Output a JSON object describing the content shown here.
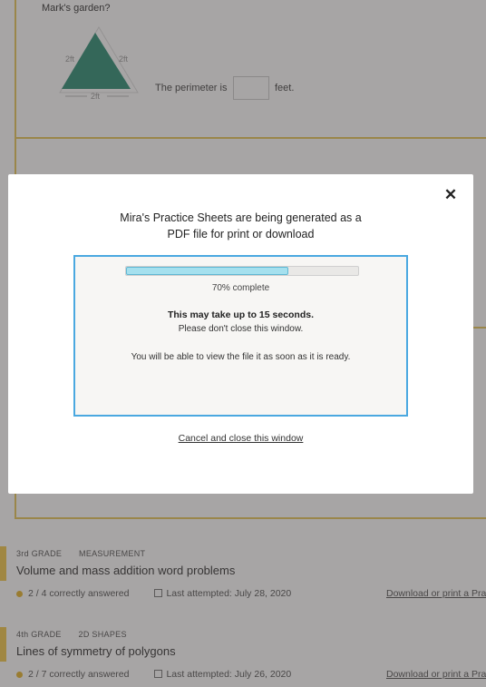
{
  "background": {
    "question": {
      "title": "Mark's garden?",
      "side_labels": [
        "2ft",
        "2ft",
        "2ft"
      ],
      "perimeter_label": "The perimeter is",
      "answer_value": "",
      "unit": "feet."
    },
    "items": [
      {
        "grade": "3rd GRADE",
        "topic": "MEASUREMENT",
        "title": "Volume and mass addition word problems",
        "score": "2 / 4 correctly answered",
        "last_attempted": "Last attempted: July 28, 2020",
        "download": "Download or print a Pra"
      },
      {
        "grade": "4th GRADE",
        "topic": "2D SHAPES",
        "title": "Lines of symmetry of polygons",
        "score": "2 / 7 correctly answered",
        "last_attempted": "Last attempted: July 26, 2020",
        "download": "Download or print a Pra"
      }
    ]
  },
  "modal": {
    "title_line1": "Mira's Practice Sheets are being generated as a",
    "title_line2": "PDF file for print or download",
    "close_icon": "close-icon",
    "progress": {
      "value": 0.7,
      "label": "70% complete"
    },
    "wait_strong": "This may take up to 15 seconds.",
    "wait_note": "Please don't close this window.",
    "ready_note": "You will be able to view the file it as soon as it is ready.",
    "cancel_label": "Cancel and close this window"
  },
  "colors": {
    "overlay": "#3c3737",
    "accent_yellow": "#f2c94c",
    "frame_yellow": "#e8c65a",
    "progress_fill": "#a5e0ee",
    "status_border": "#4aa8e0",
    "triangle": "#2f8f75"
  }
}
